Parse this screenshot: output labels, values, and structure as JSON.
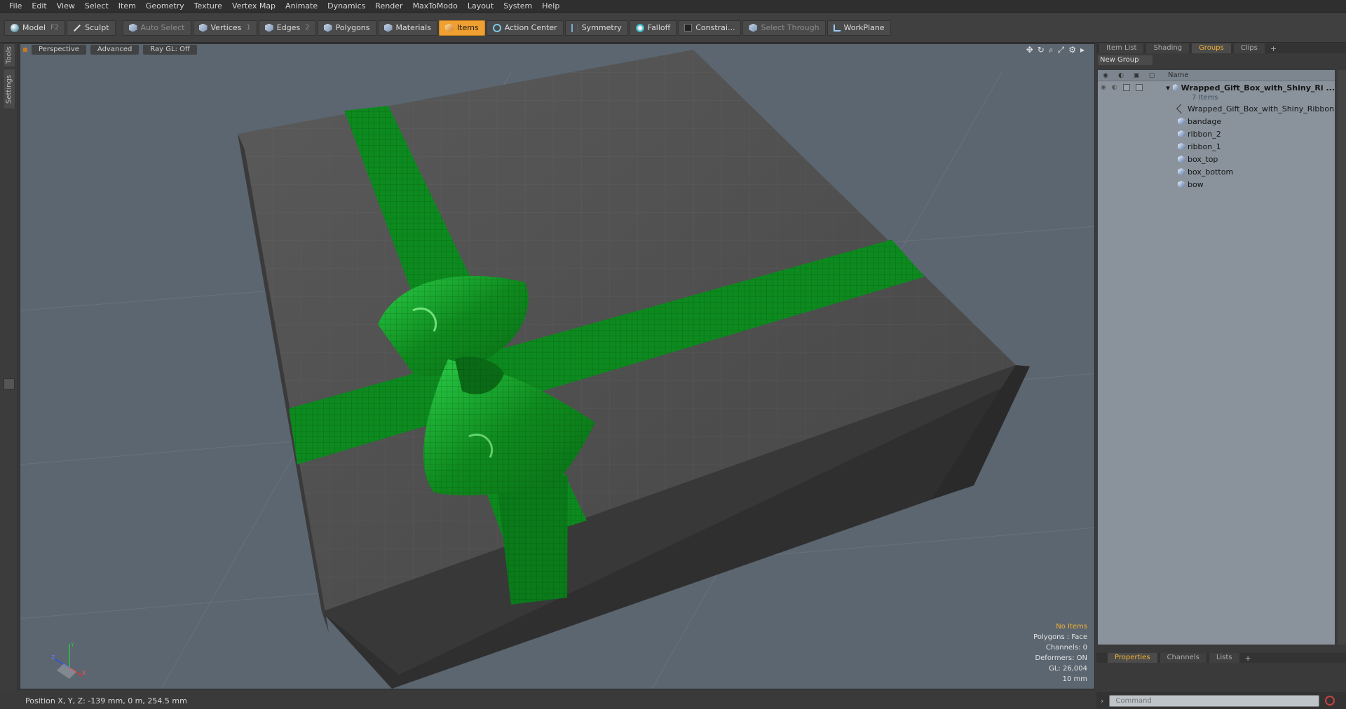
{
  "menu": [
    "File",
    "Edit",
    "View",
    "Select",
    "Item",
    "Geometry",
    "Texture",
    "Vertex Map",
    "Animate",
    "Dynamics",
    "Render",
    "MaxToModo",
    "Layout",
    "System",
    "Help"
  ],
  "toolbar": {
    "model": "Model",
    "model_key": "F2",
    "sculpt": "Sculpt",
    "auto_select": "Auto Select",
    "vertices": "Vertices",
    "vertices_key": "1",
    "edges": "Edges",
    "edges_key": "2",
    "polygons": "Polygons",
    "materials": "Materials",
    "items": "Items",
    "action_center": "Action Center",
    "symmetry": "Symmetry",
    "falloff": "Falloff",
    "constraints": "Constrai...",
    "select_through": "Select Through",
    "workplane": "WorkPlane",
    "active_color": "#f0a030"
  },
  "left_tabs": {
    "tools": "Tools",
    "settings": "Settings"
  },
  "viewport": {
    "tabs": [
      "Perspective",
      "Advanced",
      "Ray GL: Off"
    ],
    "info": {
      "no_items": "No Items",
      "polygons": "Polygons : Face",
      "channels": "Channels: 0",
      "deformers": "Deformers: ON",
      "gl": "GL: 26,004",
      "scale": "10 mm"
    },
    "axis_labels": {
      "x": "X",
      "y": "Y",
      "z": "Z"
    }
  },
  "right_panel": {
    "tabs": [
      "Item List",
      "Shading",
      "Groups",
      "Clips"
    ],
    "active_tab": "Groups",
    "new_group": "New Group",
    "name_header": "Name",
    "group": {
      "name": "Wrapped_Gift_Box_with_Shiny_Ri ...",
      "count": "7 Items"
    },
    "items": [
      "Wrapped_Gift_Box_with_Shiny_Ribbon",
      "bandage",
      "ribbon_2",
      "ribbon_1",
      "box_top",
      "box_bottom",
      "bow"
    ],
    "bottom_tabs": [
      "Properties",
      "Channels",
      "Lists"
    ],
    "command_placeholder": "Command"
  },
  "status": {
    "position": "Position X, Y, Z:   -139 mm, 0 m, 254.5 mm"
  }
}
